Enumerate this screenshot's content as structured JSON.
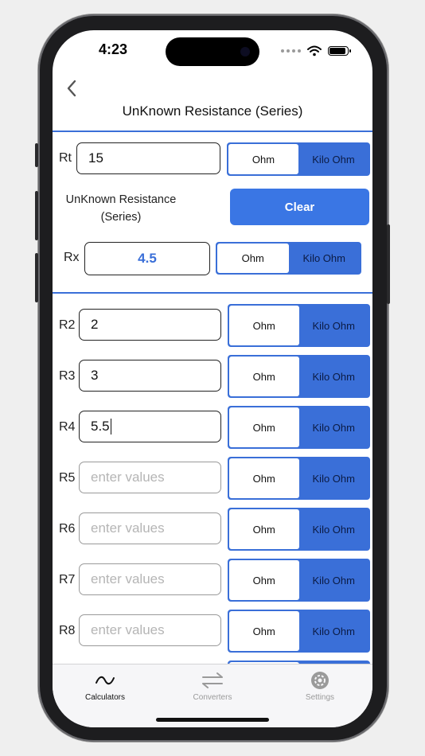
{
  "status": {
    "time": "4:23"
  },
  "nav": {
    "title": "UnKnown Resistance (Series)"
  },
  "total": {
    "label": "Rt",
    "value": "15"
  },
  "unknown": {
    "label_line1": "UnKnown Resistance",
    "label_line2": "(Series)",
    "clear_label": "Clear",
    "result_label": "Rx",
    "result_value": "4.5"
  },
  "units": {
    "ohm": "Ohm",
    "kilo_ohm": "Kilo Ohm",
    "selected": "Kilo Ohm"
  },
  "resistors": [
    {
      "label": "R2",
      "value": "2",
      "placeholder": "enter values"
    },
    {
      "label": "R3",
      "value": "3",
      "placeholder": "enter values"
    },
    {
      "label": "R4",
      "value": "5.5",
      "placeholder": "enter values"
    },
    {
      "label": "R5",
      "value": "",
      "placeholder": "enter values"
    },
    {
      "label": "R6",
      "value": "",
      "placeholder": "enter values"
    },
    {
      "label": "R7",
      "value": "",
      "placeholder": "enter values"
    },
    {
      "label": "R8",
      "value": "",
      "placeholder": "enter values"
    }
  ],
  "tabs": [
    {
      "label": "Calculators",
      "icon": "tilde-icon",
      "active": true
    },
    {
      "label": "Converters",
      "icon": "converters-arrows-icon",
      "active": false
    },
    {
      "label": "Settings",
      "icon": "gear-icon",
      "active": false
    }
  ],
  "colors": {
    "accent": "#3a6fd8",
    "button": "#3a76e4",
    "inactive_tab": "#9a9a9a"
  }
}
